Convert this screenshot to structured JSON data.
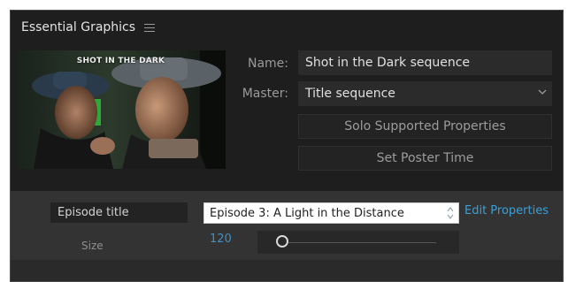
{
  "panel": {
    "title": "Essential Graphics",
    "menu_icon": "hamburger-menu-icon"
  },
  "thumbnail": {
    "caption": "SHOT IN THE DARK"
  },
  "name_row": {
    "label": "Name:",
    "value": "Shot in the Dark sequence"
  },
  "master_row": {
    "label": "Master:",
    "value": "Title sequence",
    "icon": "chevron-down-icon"
  },
  "buttons": {
    "solo": "Solo Supported Properties",
    "poster": "Set Poster Time"
  },
  "properties": {
    "episode": {
      "label": "Episode title",
      "value": "Episode 3: A Light in the Distance",
      "edit_link": "Edit Properties"
    },
    "size": {
      "label": "Size",
      "value": "120",
      "slider_fraction": 0.0
    }
  },
  "colors": {
    "panel_bg": "#1e1e1e",
    "section_bg": "#333333",
    "link": "#3d9fd6",
    "value_blue": "#3d8fc4"
  }
}
